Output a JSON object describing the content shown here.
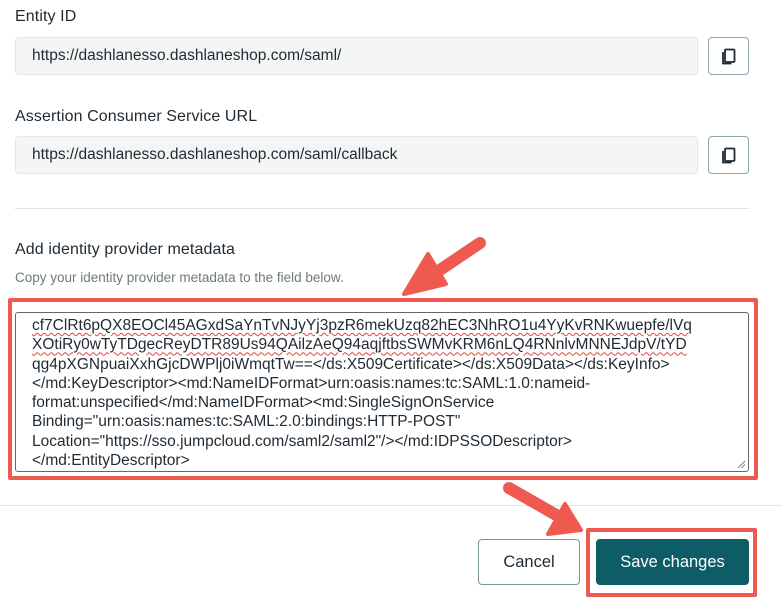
{
  "entity_id": {
    "label": "Entity ID",
    "value": "https://dashlanesso.dashlaneshop.com/saml/",
    "copy_icon": "copy-icon"
  },
  "acs_url": {
    "label": "Assertion Consumer Service URL",
    "value": "https://dashlanesso.dashlaneshop.com/saml/callback",
    "copy_icon": "copy-icon"
  },
  "metadata": {
    "label": "Add identity provider metadata",
    "helper": "Copy your identity provider metadata to the field below.",
    "lines": [
      "cf7ClRt6pQX8EOCl45AGxdSaYnTvNJyYj3pzR6mekUzq82hEC3NhRO1u4YyKvRNKwuepfe/lVq",
      "XOtiRy0wTyTDgecReyDTR89Us94QAilzAeQ94aqjftbsSWMvKRM6nLQ4RNnlvMNNEJdpV/tYD",
      "qg4pXGNpuaiXxhGjcDWPlj0iWmqtTw==</ds:X509Certificate></ds:X509Data></ds:KeyInfo>",
      "</md:KeyDescriptor><md:NameIDFormat>urn:oasis:names:tc:SAML:1.0:nameid-",
      "format:unspecified</md:NameIDFormat><md:SingleSignOnService",
      "Binding=\"urn:oasis:names:tc:SAML:2.0:bindings:HTTP-POST\"",
      "Location=\"https://sso.jumpcloud.com/saml2/saml2\"/></md:IDPSSODescriptor>",
      "</md:EntityDescriptor>"
    ]
  },
  "actions": {
    "cancel_label": "Cancel",
    "save_label": "Save changes"
  },
  "colors": {
    "primary": "#0e5c66",
    "annotation": "#ef5a50"
  }
}
